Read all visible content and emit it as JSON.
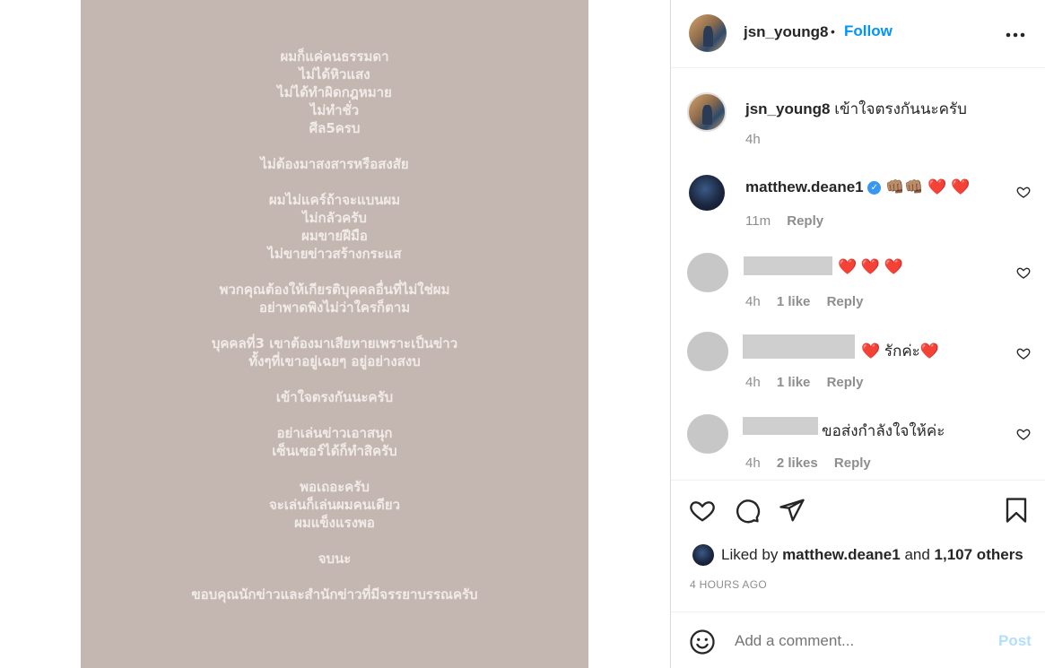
{
  "post": {
    "poem_lines": [
      "ผมก็แค่คนธรรมดา",
      "ไม่ได้หิวแสง",
      "ไม่ได้ทำผิดกฎหมาย",
      "ไม่ทำชั่ว",
      "ศีล5ครบ",
      "",
      "ไม่ต้องมาสงสารหรือสงสัย",
      "",
      "ผมไม่แคร์ถ้าจะแบนผม",
      "ไม่กลัวครับ",
      "ผมขายฝีมือ",
      "ไม่ขายข่าวสร้างกระแส",
      "",
      "พวกคุณต้องให้เกียรติบุคคลอื่นที่ไม่ใช่ผม",
      "อย่าพาดพิงไม่ว่าใครก็ตาม",
      "",
      "บุคคลที่3 เขาต้องมาเสียหายเพราะเป็นข่าว",
      "ทั้งๆที่เขาอยู่เฉยๆ อยู่อย่างสงบ",
      "",
      "เข้าใจตรงกันนะครับ",
      "",
      "อย่าเล่นข่าวเอาสนุก",
      "เซ็นเซอร์ได้ก็ทำสิครับ",
      "",
      "พอเถอะครับ",
      "จะเล่นก็เล่นผมคนเดียว",
      "ผมแข็งแรงพอ",
      "",
      "จบนะ",
      "",
      "ขอบคุณนักข่าวและสำนักข่าวที่มีจรรยาบรรณครับ"
    ]
  },
  "header": {
    "username": "jsn_young8",
    "separator": "•",
    "follow_label": "Follow",
    "more_label": "•••"
  },
  "caption": {
    "username": "jsn_young8",
    "text": "เข้าใจตรงกันนะครับ",
    "time": "4h"
  },
  "comments": [
    {
      "username": "matthew.deane1",
      "verified": true,
      "text": "👊🏽👊🏽 ❤️ ❤️",
      "time": "11m",
      "likes": "",
      "reply": "Reply"
    },
    {
      "username": "",
      "text": "❤️ ❤️ ❤️",
      "time": "4h",
      "likes": "1 like",
      "reply": "Reply"
    },
    {
      "username": "",
      "text": "❤️ รักค่ะ❤️",
      "time": "4h",
      "likes": "1 like",
      "reply": "Reply"
    },
    {
      "username": "",
      "text": "ขอส่งกำลังใจให้ค่ะ",
      "time": "4h",
      "likes": "2 likes",
      "reply": "Reply"
    }
  ],
  "likes_line": {
    "prefix": "Liked by",
    "user": "matthew.deane1",
    "middle": "and",
    "others": "1,107 others"
  },
  "time_ago": "4 HOURS AGO",
  "add_comment": {
    "placeholder": "Add a comment...",
    "post_label": "Post"
  },
  "colors": {
    "follow": "#0095f6",
    "post_disabled": "#b2dffc",
    "media_bg": "#c4b7b1",
    "heart_red": "#ed1c2e"
  }
}
